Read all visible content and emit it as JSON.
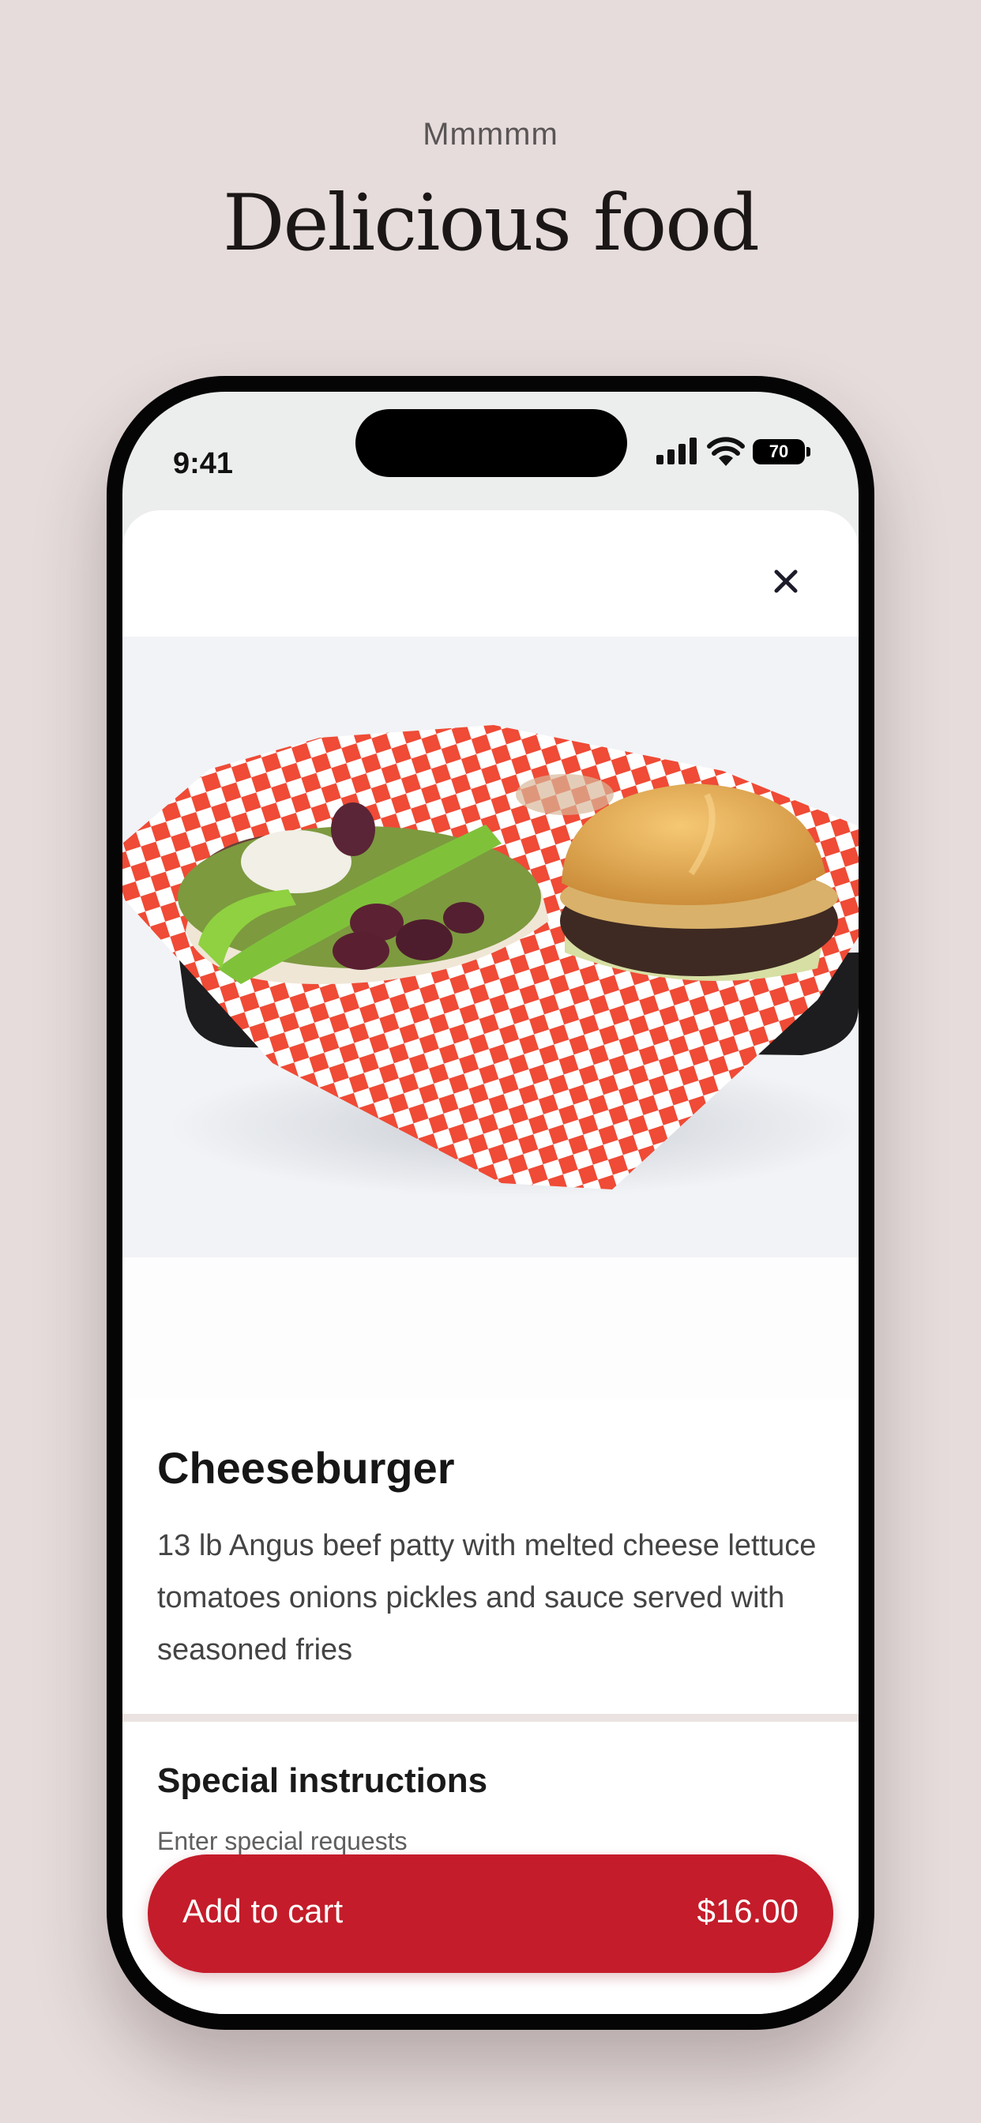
{
  "header": {
    "eyebrow": "Mmmmm",
    "headline": "Delicious food"
  },
  "status_bar": {
    "time": "9:41",
    "battery": "70",
    "icons": [
      "cellular-signal-icon",
      "wifi-icon",
      "battery-icon"
    ]
  },
  "item": {
    "photo_icon": "cheeseburger-basket-photo",
    "title": "Cheeseburger",
    "description": "13 lb Angus beef patty with melted cheese lettuce tomatoes onions pickles and sauce served with seasoned fries"
  },
  "instructions": {
    "title": "Special instructions",
    "placeholder": "Enter special requests"
  },
  "cart": {
    "label": "Add to cart",
    "price": "$16.00"
  },
  "colors": {
    "page_background": "#e6dcdc",
    "accent": "#c41c2a"
  }
}
